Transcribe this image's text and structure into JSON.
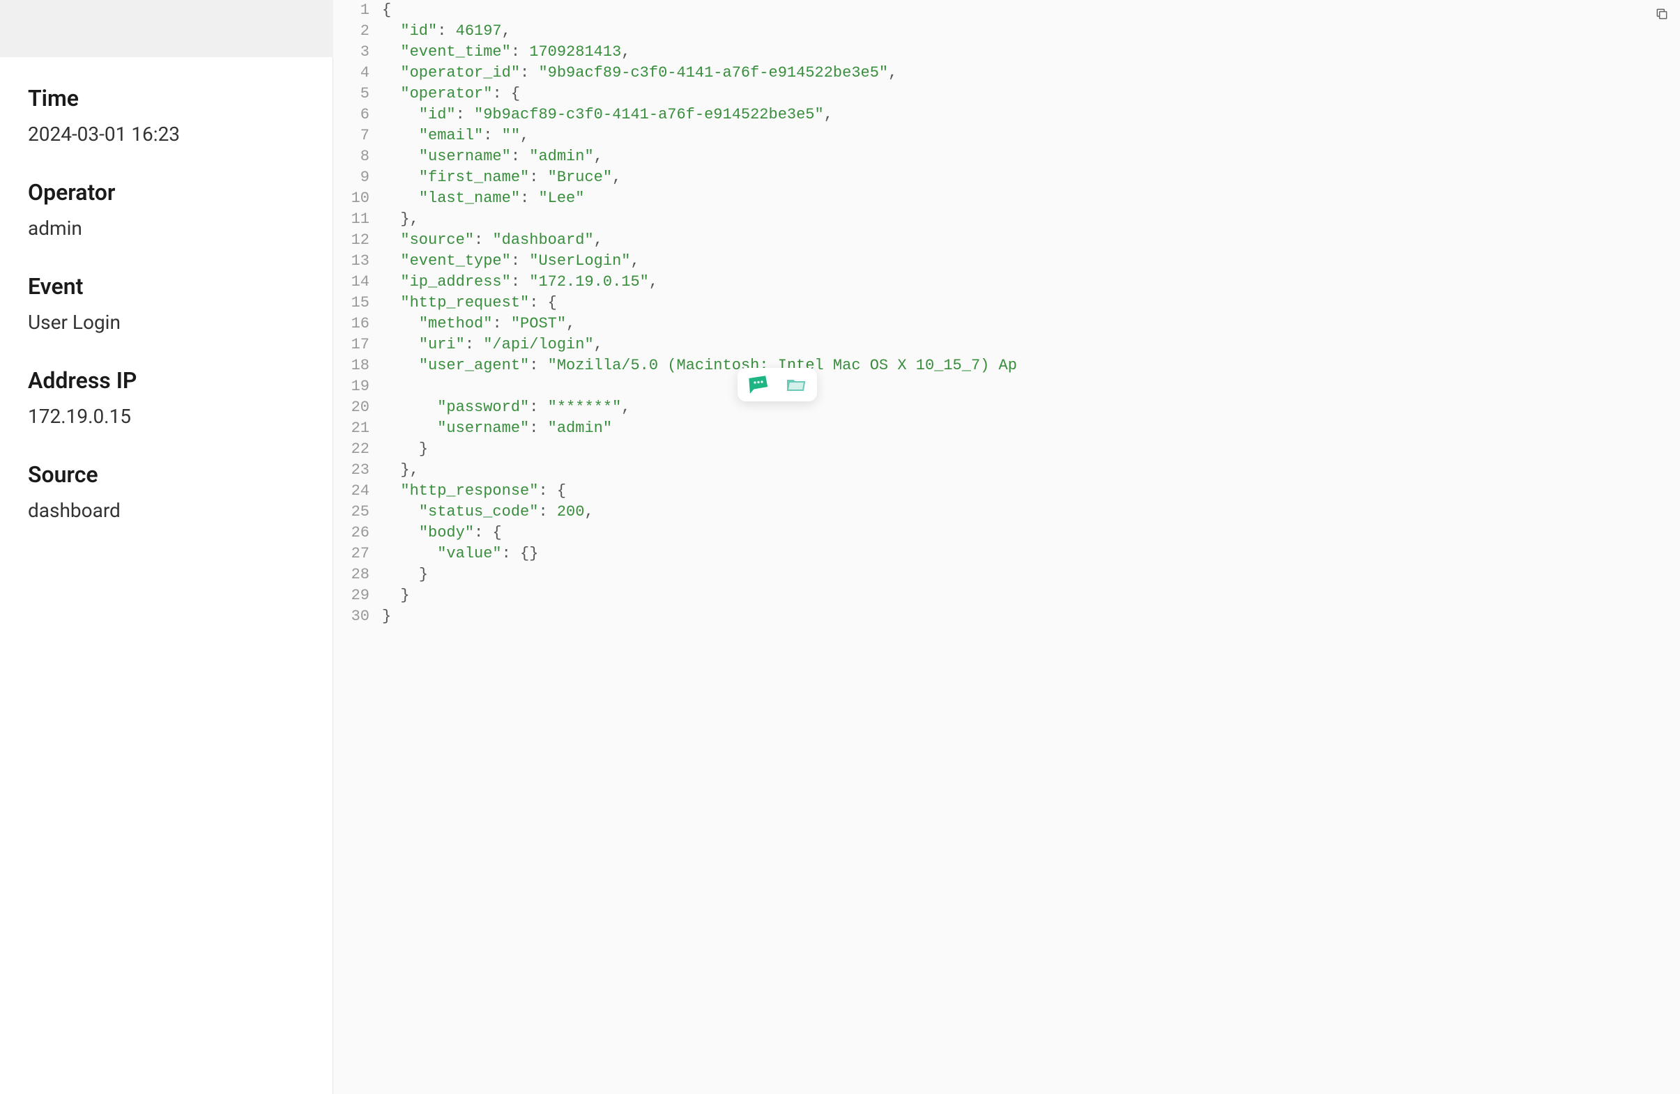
{
  "sidebar": {
    "time": {
      "label": "Time",
      "value": "2024-03-01 16:23"
    },
    "operator": {
      "label": "Operator",
      "value": "admin"
    },
    "event": {
      "label": "Event",
      "value": "User Login"
    },
    "address_ip": {
      "label": "Address IP",
      "value": "172.19.0.15"
    },
    "source": {
      "label": "Source",
      "value": "dashboard"
    }
  },
  "code_lines": [
    {
      "n": "1",
      "segs": [
        [
          "{",
          "punct"
        ]
      ]
    },
    {
      "n": "2",
      "segs": [
        [
          "  ",
          "plain"
        ],
        [
          "\"id\"",
          "key"
        ],
        [
          ": ",
          "punct"
        ],
        [
          "46197",
          "number"
        ],
        [
          ",",
          "punct"
        ]
      ]
    },
    {
      "n": "3",
      "segs": [
        [
          "  ",
          "plain"
        ],
        [
          "\"event_time\"",
          "key"
        ],
        [
          ": ",
          "punct"
        ],
        [
          "1709281413",
          "number"
        ],
        [
          ",",
          "punct"
        ]
      ]
    },
    {
      "n": "4",
      "segs": [
        [
          "  ",
          "plain"
        ],
        [
          "\"operator_id\"",
          "key"
        ],
        [
          ": ",
          "punct"
        ],
        [
          "\"9b9acf89-c3f0-4141-a76f-e914522be3e5\"",
          "string"
        ],
        [
          ",",
          "punct"
        ]
      ]
    },
    {
      "n": "5",
      "segs": [
        [
          "  ",
          "plain"
        ],
        [
          "\"operator\"",
          "key"
        ],
        [
          ": ",
          "punct"
        ],
        [
          "{",
          "punct"
        ]
      ]
    },
    {
      "n": "6",
      "segs": [
        [
          "    ",
          "plain"
        ],
        [
          "\"id\"",
          "key"
        ],
        [
          ": ",
          "punct"
        ],
        [
          "\"9b9acf89-c3f0-4141-a76f-e914522be3e5\"",
          "string"
        ],
        [
          ",",
          "punct"
        ]
      ]
    },
    {
      "n": "7",
      "segs": [
        [
          "    ",
          "plain"
        ],
        [
          "\"email\"",
          "key"
        ],
        [
          ": ",
          "punct"
        ],
        [
          "\"\"",
          "string"
        ],
        [
          ",",
          "punct"
        ]
      ]
    },
    {
      "n": "8",
      "segs": [
        [
          "    ",
          "plain"
        ],
        [
          "\"username\"",
          "key"
        ],
        [
          ": ",
          "punct"
        ],
        [
          "\"admin\"",
          "string"
        ],
        [
          ",",
          "punct"
        ]
      ]
    },
    {
      "n": "9",
      "segs": [
        [
          "    ",
          "plain"
        ],
        [
          "\"first_name\"",
          "key"
        ],
        [
          ": ",
          "punct"
        ],
        [
          "\"Bruce\"",
          "string"
        ],
        [
          ",",
          "punct"
        ]
      ]
    },
    {
      "n": "10",
      "segs": [
        [
          "    ",
          "plain"
        ],
        [
          "\"last_name\"",
          "key"
        ],
        [
          ": ",
          "punct"
        ],
        [
          "\"Lee\"",
          "string"
        ]
      ]
    },
    {
      "n": "11",
      "segs": [
        [
          "  ",
          "plain"
        ],
        [
          "},",
          "punct"
        ]
      ]
    },
    {
      "n": "12",
      "segs": [
        [
          "  ",
          "plain"
        ],
        [
          "\"source\"",
          "key"
        ],
        [
          ": ",
          "punct"
        ],
        [
          "\"dashboard\"",
          "string"
        ],
        [
          ",",
          "punct"
        ]
      ]
    },
    {
      "n": "13",
      "segs": [
        [
          "  ",
          "plain"
        ],
        [
          "\"event_type\"",
          "key"
        ],
        [
          ": ",
          "punct"
        ],
        [
          "\"UserLogin\"",
          "string"
        ],
        [
          ",",
          "punct"
        ]
      ]
    },
    {
      "n": "14",
      "segs": [
        [
          "  ",
          "plain"
        ],
        [
          "\"ip_address\"",
          "key"
        ],
        [
          ": ",
          "punct"
        ],
        [
          "\"172.19.0.15\"",
          "string"
        ],
        [
          ",",
          "punct"
        ]
      ]
    },
    {
      "n": "15",
      "segs": [
        [
          "  ",
          "plain"
        ],
        [
          "\"http_request\"",
          "key"
        ],
        [
          ": ",
          "punct"
        ],
        [
          "{",
          "punct"
        ]
      ]
    },
    {
      "n": "16",
      "segs": [
        [
          "    ",
          "plain"
        ],
        [
          "\"method\"",
          "key"
        ],
        [
          ": ",
          "punct"
        ],
        [
          "\"POST\"",
          "string"
        ],
        [
          ",",
          "punct"
        ]
      ]
    },
    {
      "n": "17",
      "segs": [
        [
          "    ",
          "plain"
        ],
        [
          "\"uri\"",
          "key"
        ],
        [
          ": ",
          "punct"
        ],
        [
          "\"/api/login\"",
          "string"
        ],
        [
          ",",
          "punct"
        ]
      ]
    },
    {
      "n": "18",
      "segs": [
        [
          "    ",
          "plain"
        ],
        [
          "\"user_agent\"",
          "key"
        ],
        [
          ": ",
          "punct"
        ],
        [
          "\"Mozilla/5.0 (Macintosh; Intel Mac OS X 10_15_7) Ap",
          "string"
        ]
      ]
    },
    {
      "n": "19",
      "segs": [
        [
          "",
          "plain"
        ]
      ]
    },
    {
      "n": "20",
      "segs": [
        [
          "      ",
          "plain"
        ],
        [
          "\"password\"",
          "key"
        ],
        [
          ": ",
          "punct"
        ],
        [
          "\"******\"",
          "string"
        ],
        [
          ",",
          "punct"
        ]
      ]
    },
    {
      "n": "21",
      "segs": [
        [
          "      ",
          "plain"
        ],
        [
          "\"username\"",
          "key"
        ],
        [
          ": ",
          "punct"
        ],
        [
          "\"admin\"",
          "string"
        ]
      ]
    },
    {
      "n": "22",
      "segs": [
        [
          "    ",
          "plain"
        ],
        [
          "}",
          "punct"
        ]
      ]
    },
    {
      "n": "23",
      "segs": [
        [
          "  ",
          "plain"
        ],
        [
          "},",
          "punct"
        ]
      ]
    },
    {
      "n": "24",
      "segs": [
        [
          "  ",
          "plain"
        ],
        [
          "\"http_response\"",
          "key"
        ],
        [
          ": ",
          "punct"
        ],
        [
          "{",
          "punct"
        ]
      ]
    },
    {
      "n": "25",
      "segs": [
        [
          "    ",
          "plain"
        ],
        [
          "\"status_code\"",
          "key"
        ],
        [
          ": ",
          "punct"
        ],
        [
          "200",
          "number"
        ],
        [
          ",",
          "punct"
        ]
      ]
    },
    {
      "n": "26",
      "segs": [
        [
          "    ",
          "plain"
        ],
        [
          "\"body\"",
          "key"
        ],
        [
          ": ",
          "punct"
        ],
        [
          "{",
          "punct"
        ]
      ]
    },
    {
      "n": "27",
      "segs": [
        [
          "      ",
          "plain"
        ],
        [
          "\"value\"",
          "key"
        ],
        [
          ": ",
          "punct"
        ],
        [
          "{}",
          "punct"
        ]
      ]
    },
    {
      "n": "28",
      "segs": [
        [
          "    ",
          "plain"
        ],
        [
          "}",
          "punct"
        ]
      ]
    },
    {
      "n": "29",
      "segs": [
        [
          "  ",
          "plain"
        ],
        [
          "}",
          "punct"
        ]
      ]
    },
    {
      "n": "30",
      "segs": [
        [
          "}",
          "punct"
        ]
      ]
    }
  ],
  "popup": {
    "icon1": "chat-icon",
    "icon2": "folder-icon"
  }
}
